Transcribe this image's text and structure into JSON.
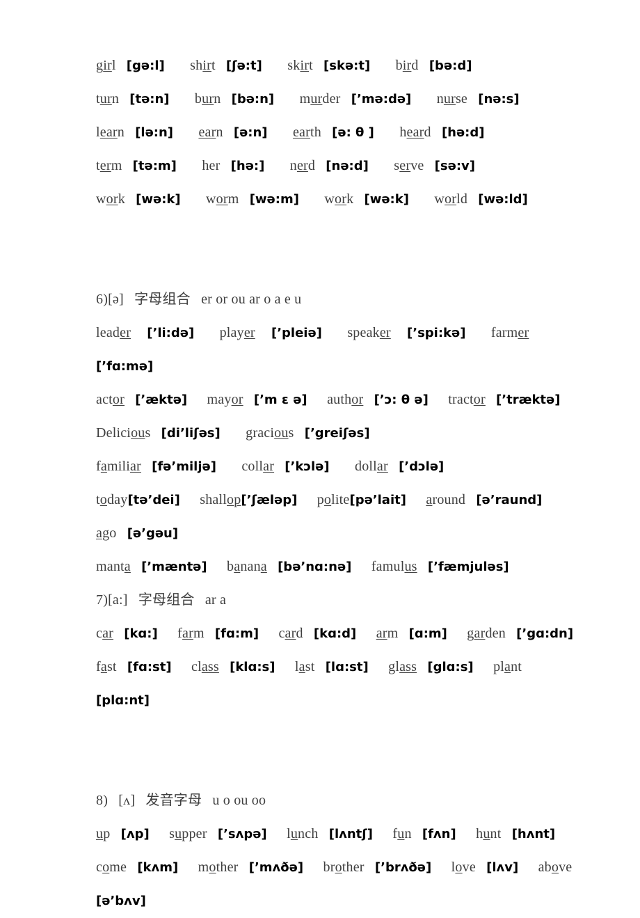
{
  "document": {
    "type": "phonetics-worksheet",
    "language": "zh-CN / en",
    "background_color": "#ffffff",
    "text_color": "#3f3f3f",
    "phonetic_color": "#000000"
  },
  "lines": [
    {
      "id": "l1",
      "kind": "words",
      "entries": [
        {
          "pre": "g",
          "mark": "ir",
          "post": "l",
          "ipa": "[gə:l]"
        },
        {
          "pre": "sh",
          "mark": "ir",
          "post": "t",
          "ipa": "[ʃə:t]"
        },
        {
          "pre": "sk",
          "mark": "ir",
          "post": "t",
          "ipa": "[skə:t]"
        },
        {
          "pre": "b",
          "mark": "ir",
          "post": "d",
          "ipa": "[bə:d]"
        }
      ]
    },
    {
      "id": "l2",
      "kind": "words",
      "entries": [
        {
          "pre": "t",
          "mark": "ur",
          "post": "n",
          "ipa": "[tə:n]"
        },
        {
          "pre": "b",
          "mark": "ur",
          "post": "n",
          "ipa": "[bə:n]"
        },
        {
          "pre": "m",
          "mark": "ur",
          "post": "der",
          "ipa": "[’mə:də]"
        },
        {
          "pre": "n",
          "mark": "ur",
          "post": "se",
          "ipa": "[nə:s]"
        }
      ]
    },
    {
      "id": "l3",
      "kind": "words",
      "entries": [
        {
          "pre": "l",
          "mark": "ear",
          "post": "n",
          "ipa": "[lə:n]"
        },
        {
          "pre": "",
          "mark": "ear",
          "post": "n",
          "ipa": "[ə:n]"
        },
        {
          "pre": "",
          "mark": "ear",
          "post": "th",
          "ipa": "[ə: θ ]"
        },
        {
          "pre": "h",
          "mark": "ear",
          "post": "d",
          "ipa": "[hə:d]"
        }
      ]
    },
    {
      "id": "l4",
      "kind": "words",
      "entries": [
        {
          "pre": "t",
          "mark": "er",
          "post": "m",
          "ipa": "[tə:m]"
        },
        {
          "pre": "her",
          "mark": "",
          "post": "",
          "ipa": "[hə:]"
        },
        {
          "pre": "n",
          "mark": "er",
          "post": "d",
          "ipa": "[nə:d]"
        },
        {
          "pre": "s",
          "mark": "er",
          "post": "ve",
          "ipa": "[sə:v]"
        }
      ]
    },
    {
      "id": "l5",
      "kind": "words",
      "entries": [
        {
          "pre": "w",
          "mark": "or",
          "post": "k",
          "ipa": "[wə:k]"
        },
        {
          "pre": "w",
          "mark": "or",
          "post": "m",
          "ipa": "[wə:m]"
        },
        {
          "pre": "w",
          "mark": "or",
          "post": "k",
          "ipa": "[wə:k]"
        },
        {
          "pre": "w",
          "mark": "or",
          "post": "ld",
          "ipa": "[wə:ld]"
        }
      ]
    },
    {
      "id": "h6",
      "kind": "heading",
      "number": "6)",
      "ipa": "[ə]",
      "cjk": "字母组合",
      "letters": "er   or   ou   ar   o   a   e   u"
    },
    {
      "id": "l6a",
      "kind": "words",
      "entries": [
        {
          "pre": "lead",
          "mark": "er",
          "post": "",
          "ipa": "[’li:də]"
        },
        {
          "pre": "play",
          "mark": "er",
          "post": "",
          "ipa": "[’pleiə]"
        },
        {
          "pre": "speak",
          "mark": "er",
          "post": "",
          "ipa": "[’spi:kə]"
        },
        {
          "pre": "farm",
          "mark": "er",
          "post": "",
          "ipa": ""
        }
      ]
    },
    {
      "id": "l6b",
      "kind": "ipa-only",
      "ipa": "[’fɑ:mə]"
    },
    {
      "id": "l6c",
      "kind": "words",
      "entries": [
        {
          "pre": "act",
          "mark": "or",
          "post": "",
          "ipa": "[’æktə]"
        },
        {
          "pre": "may",
          "mark": "or",
          "post": "",
          "ipa": "[’m ɛ ə]"
        },
        {
          "pre": "auth",
          "mark": "or",
          "post": "",
          "ipa": "[’ɔ: θ ə]"
        },
        {
          "pre": "tract",
          "mark": "or",
          "post": "",
          "ipa": "[’træktə]"
        }
      ]
    },
    {
      "id": "l6d",
      "kind": "words",
      "entries": [
        {
          "pre": "Delici",
          "mark": "ou",
          "post": "s",
          "ipa": "[di’liʃəs]"
        },
        {
          "pre": "graci",
          "mark": "ou",
          "post": "s",
          "ipa": "[’greiʃəs]"
        }
      ]
    },
    {
      "id": "l6e",
      "kind": "words",
      "entries": [
        {
          "pre": "f",
          "mark": "a",
          "mid": "mili",
          "mark2": "ar",
          "post": "",
          "ipa": "[fə’miljə]"
        },
        {
          "pre": "coll",
          "mark": "ar",
          "post": "",
          "ipa": "[’kɔlə]"
        },
        {
          "pre": "doll",
          "mark": "ar",
          "post": "",
          "ipa": "[’dɔlə]"
        }
      ]
    },
    {
      "id": "l6f",
      "kind": "words",
      "entries": [
        {
          "pre": "t",
          "mark": "o",
          "post": "day",
          "ipa": "[tə’dei]",
          "tight": true
        },
        {
          "pre": "shall",
          "mark": "op",
          "post": "",
          "ipa": "[’ʃæləp]",
          "tight": true
        },
        {
          "pre": "p",
          "mark": "o",
          "post": "lite",
          "ipa": "[pə’lait]",
          "tight": true
        },
        {
          "pre": "",
          "mark": "a",
          "post": "round",
          "ipa": "[ə’raund]"
        }
      ]
    },
    {
      "id": "l6g",
      "kind": "words",
      "entries": [
        {
          "pre": "",
          "mark": "a",
          "post": "go",
          "ipa": "[ə’gəu]"
        }
      ]
    },
    {
      "id": "l6h",
      "kind": "words",
      "entries": [
        {
          "pre": "mant",
          "mark": "a",
          "post": "",
          "ipa": "[’mæntə]"
        },
        {
          "pre": "b",
          "mark": "a",
          "mid": "nan",
          "mark2": "a",
          "post": "",
          "ipa": "[bə’nɑ:nə]"
        },
        {
          "pre": "famul",
          "mark": "us",
          "post": "",
          "ipa": "[’fæmjuləs]"
        }
      ]
    },
    {
      "id": "h7",
      "kind": "heading",
      "number": "7)",
      "ipa": "[a:]",
      "cjk": "字母组合",
      "letters": "ar  a"
    },
    {
      "id": "l7a",
      "kind": "words",
      "entries": [
        {
          "pre": "c",
          "mark": "ar",
          "post": "",
          "ipa": "[kɑ:]"
        },
        {
          "pre": "f",
          "mark": "ar",
          "post": "m",
          "ipa": "[fɑ:m]"
        },
        {
          "pre": "c",
          "mark": "ar",
          "post": "d",
          "ipa": "[kɑ:d]"
        },
        {
          "pre": "",
          "mark": "ar",
          "post": "m",
          "ipa": "[ɑ:m]"
        },
        {
          "pre": "g",
          "mark": "ar",
          "post": "den",
          "ipa": "[’gɑ:dn]"
        }
      ]
    },
    {
      "id": "l7b",
      "kind": "words",
      "entries": [
        {
          "pre": "f",
          "mark": "a",
          "post": "st",
          "ipa": "[fɑ:st]"
        },
        {
          "pre": "cl",
          "mark": "ass",
          "post": "",
          "ipa": "[klɑ:s]"
        },
        {
          "pre": "l",
          "mark": "a",
          "post": "st",
          "ipa": "[lɑ:st]"
        },
        {
          "pre": "gl",
          "mark": "ass",
          "post": "",
          "ipa": "[glɑ:s]"
        },
        {
          "pre": "pl",
          "mark": "a",
          "post": "nt",
          "ipa": ""
        }
      ]
    },
    {
      "id": "l7c",
      "kind": "ipa-only",
      "ipa": "[plɑ:nt]"
    },
    {
      "id": "h8",
      "kind": "heading",
      "number": "8)",
      "ipa": "[ʌ]",
      "cjk": "发音字母",
      "letters": "u  o  ou  oo"
    },
    {
      "id": "l8a",
      "kind": "words",
      "entries": [
        {
          "pre": "",
          "mark": "u",
          "post": "p",
          "ipa": "[ʌp]"
        },
        {
          "pre": "s",
          "mark": "u",
          "post": "pper",
          "ipa": "[’sʌpə]"
        },
        {
          "pre": "l",
          "mark": "u",
          "post": "nch",
          "ipa": "[lʌntʃ]"
        },
        {
          "pre": "f",
          "mark": "u",
          "post": "n",
          "ipa": "[fʌn]"
        },
        {
          "pre": "h",
          "mark": "u",
          "post": "nt",
          "ipa": "[hʌnt]"
        }
      ]
    },
    {
      "id": "l8b",
      "kind": "words",
      "entries": [
        {
          "pre": "c",
          "mark": "o",
          "post": "me",
          "ipa": "[kʌm]"
        },
        {
          "pre": "m",
          "mark": "o",
          "post": "ther",
          "ipa": "[’mʌðə]"
        },
        {
          "pre": "br",
          "mark": "o",
          "post": "ther",
          "ipa": "[’brʌðə]"
        },
        {
          "pre": "l",
          "mark": "o",
          "post": "ve",
          "ipa": "[lʌv]"
        },
        {
          "pre": "ab",
          "mark": "o",
          "post": "ve",
          "ipa": ""
        }
      ]
    },
    {
      "id": "l8c",
      "kind": "ipa-only",
      "ipa": "[ə’bʌv]"
    }
  ]
}
